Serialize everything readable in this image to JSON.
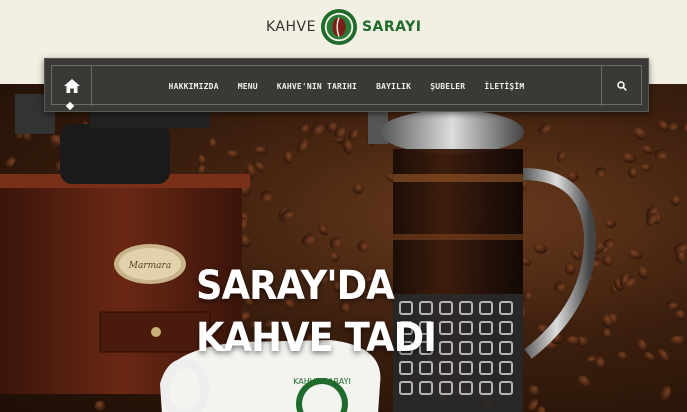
{
  "brand": {
    "name_left": "KAHVE",
    "name_right": "SARAYI",
    "emblem_icon": "coffee-emblem-icon",
    "colors": {
      "green": "#1f6b2c",
      "dark": "#333333",
      "cream": "#f2efe3"
    }
  },
  "nav": {
    "home_icon": "home-icon",
    "search_icon": "search-icon",
    "items": [
      {
        "label": "HAKKIMIZDA"
      },
      {
        "label": "MENU"
      },
      {
        "label": "KAHVE'NIN TARIHI"
      },
      {
        "label": "BAYILIK"
      },
      {
        "label": "ŞUBELER"
      },
      {
        "label": "İLETİŞİM"
      }
    ],
    "colors": {
      "bar": "#3b3935",
      "text": "#f0eee8"
    }
  },
  "hero": {
    "headline_line1": "SARAY'DA",
    "headline_line2": "KAHVE TADI",
    "grinder_badge": "Marmara",
    "cup_label": "KAHVE SARAYI"
  }
}
